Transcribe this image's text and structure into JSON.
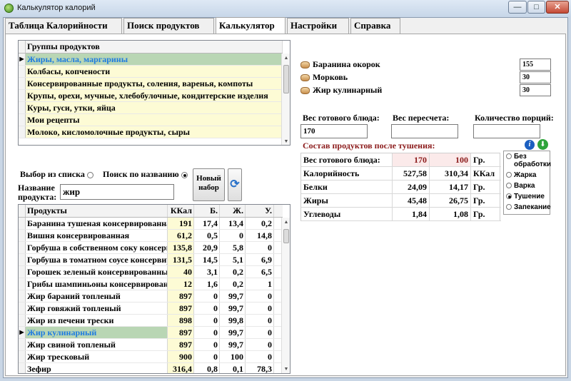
{
  "window": {
    "title": "Калькулятор калорий",
    "minimize": "—",
    "maximize": "□",
    "close": "✕"
  },
  "tabs": [
    "Таблица Калорийности",
    "Поиск продуктов",
    "Калькулятор",
    "Настройки",
    "Справка"
  ],
  "active_tab": "Калькулятор",
  "groups": {
    "header": "Группы продуктов",
    "selected_index": 0,
    "items": [
      "Жиры, масла, маргарины",
      "Колбасы, копчености",
      "Консервированные продукты, соления, варенья, компоты",
      "Крупы, орехи, мучные, хлебобулочные, кондитерские изделия",
      "Куры, гуси, утки, яйца",
      "Мои рецепты",
      "Молоко, кисломолочные продукты, сыры"
    ]
  },
  "search": {
    "from_list_label": "Выбор из списка",
    "by_name_label": "Поиск по названию",
    "mode": "by_name",
    "name_label_1": "Название",
    "name_label_2": "продукта:",
    "name_value": "жир",
    "new_set_label_1": "Новый",
    "new_set_label_2": "набор",
    "refresh_icon": "⟳"
  },
  "products": {
    "columns": [
      "Продукты",
      "ККал",
      "Б.",
      "Ж.",
      "У."
    ],
    "selected_index": 9,
    "rows": [
      [
        "Баранина тушеная консервированная",
        "191",
        "17,4",
        "13,4",
        "0,2"
      ],
      [
        "Вишня консервированная",
        "61,2",
        "0,5",
        "0",
        "14,8"
      ],
      [
        "Горбуша в собственном соку консервированная",
        "135,8",
        "20,9",
        "5,8",
        "0"
      ],
      [
        "Горбуша в томатном соусе консервированная",
        "131,5",
        "14,5",
        "5,1",
        "6,9"
      ],
      [
        "Горошек зеленый консервированный",
        "40",
        "3,1",
        "0,2",
        "6,5"
      ],
      [
        "Грибы шампиньоны консервированные",
        "12",
        "1,6",
        "0,2",
        "1"
      ],
      [
        "Жир бараний топленый",
        "897",
        "0",
        "99,7",
        "0"
      ],
      [
        "Жир говяжий топленый",
        "897",
        "0",
        "99,7",
        "0"
      ],
      [
        "Жир из печени трески",
        "898",
        "0",
        "99,8",
        "0"
      ],
      [
        "Жир кулинарный",
        "897",
        "0",
        "99,7",
        "0"
      ],
      [
        "Жир свиной топленый",
        "897",
        "0",
        "99,7",
        "0"
      ],
      [
        "Жир тресковый",
        "900",
        "0",
        "100",
        "0"
      ],
      [
        "Зефир",
        "316,4",
        "0,8",
        "0,1",
        "78,3"
      ]
    ]
  },
  "ingredients": [
    {
      "name": "Баранина окорок",
      "value": "155"
    },
    {
      "name": "Морковь",
      "value": "30"
    },
    {
      "name": "Жир кулинарный",
      "value": "30"
    }
  ],
  "weights": {
    "ready_label": "Вес готового блюда:",
    "ready_value": "170",
    "recalc_label": "Вес пересчета:",
    "recalc_value": "",
    "portions_label": "Количество порций:",
    "portions_value": ""
  },
  "icons": {
    "info": "i",
    "download": "⬇"
  },
  "composition": {
    "title": "Состав продуктов после тушения:",
    "weight_row": {
      "label": "Вес готового блюда:",
      "v1": "170",
      "v2": "100",
      "unit": "Гр."
    },
    "rows": [
      {
        "label": "Калорийность",
        "v1": "527,58",
        "v2": "310,34",
        "unit": "ККал"
      },
      {
        "label": "Белки",
        "v1": "24,09",
        "v2": "14,17",
        "unit": "Гр."
      },
      {
        "label": "Жиры",
        "v1": "45,48",
        "v2": "26,75",
        "unit": "Гр."
      },
      {
        "label": "Углеводы",
        "v1": "1,84",
        "v2": "1,08",
        "unit": "Гр."
      }
    ]
  },
  "processing": {
    "selected": "Тушение",
    "options": [
      {
        "label": "Без обработки"
      },
      {
        "label": "Жарка"
      },
      {
        "label": "Варка"
      },
      {
        "label": "Тушение"
      },
      {
        "label": "Запекание"
      }
    ]
  },
  "colors": {
    "selected_row": "#b9d6b4",
    "selected_text": "#1e7be0",
    "number_cell": "#fdfbd5",
    "title_red": "#8b1a1a"
  }
}
